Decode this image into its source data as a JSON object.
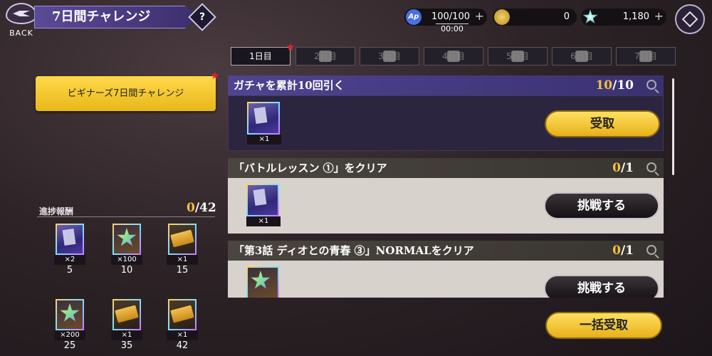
{
  "header": {
    "back_label": "BACK",
    "title": "7日間チャレンジ",
    "help_label": "?",
    "ap": {
      "icon": "ap-icon",
      "label": "Ap",
      "value": "100/100",
      "timer": "00:00"
    },
    "coin": {
      "icon": "coin-icon",
      "value": "0"
    },
    "gem": {
      "icon": "star-gem-icon",
      "value": "1,180"
    }
  },
  "left": {
    "beginner_button": "ビギナーズ7日間チャレンジ",
    "progress_label": "進捗報酬",
    "progress_current": "0",
    "progress_total": "/42",
    "rewards": [
      {
        "icon": "gacha-card-icon",
        "count": "×2",
        "day": "5"
      },
      {
        "icon": "star-piece-icon",
        "count": "×100",
        "day": "10"
      },
      {
        "icon": "u-ticket-icon",
        "count": "×1",
        "day": "15"
      },
      {
        "icon": "star-piece-icon",
        "count": "×200",
        "day": "25"
      },
      {
        "icon": "s-ticket-icon",
        "count": "×1",
        "day": "35"
      },
      {
        "icon": "a-ticket-icon",
        "count": "×1",
        "day": "42"
      }
    ]
  },
  "tabs": [
    {
      "label": "1日目",
      "active": true
    },
    {
      "label": "2日目",
      "locked": true
    },
    {
      "label": "3日目",
      "locked": true
    },
    {
      "label": "4日目",
      "locked": true
    },
    {
      "label": "5日目",
      "locked": true
    },
    {
      "label": "6日目",
      "locked": true
    },
    {
      "label": "7日目",
      "locked": true
    }
  ],
  "missions": [
    {
      "title": "ガチャを累計10回引く",
      "current": "10",
      "total": "/10",
      "reward_icon": "gacha-card-icon",
      "reward_count": "×1",
      "button": "受取",
      "state": "claimable"
    },
    {
      "title": "「バトルレッスン ①」をクリア",
      "current": "0",
      "total": "/1",
      "reward_icon": "gacha-card-icon",
      "reward_count": "×1",
      "button": "挑戦する",
      "state": "challenge"
    },
    {
      "title": "「第3話 ディオとの青春 ③」NORMALをクリア",
      "current": "0",
      "total": "/1",
      "reward_icon": "star-piece-icon",
      "reward_count": "",
      "button": "挑戦する",
      "state": "challenge"
    }
  ],
  "claim_all_button": "一括受取",
  "colors": {
    "accent_gold": "#f2c040",
    "header_purple": "#4a3d85",
    "mission_active_bg": "#2c2640",
    "mission_light_bg": "#d7d2cc"
  }
}
